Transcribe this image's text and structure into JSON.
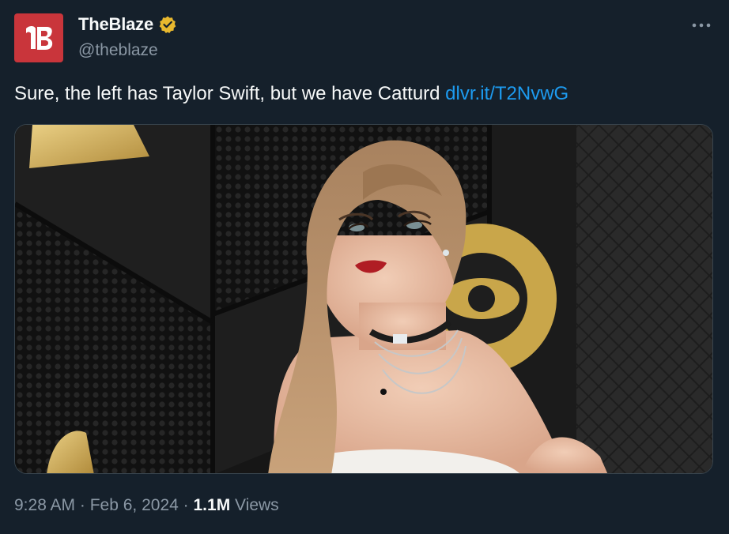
{
  "author": {
    "display_name": "TheBlaze",
    "handle": "@theblaze",
    "verified": true,
    "avatar_icon": "blaze-logo-icon",
    "avatar_color": "#c9353b",
    "badge_color": "#e8b82e"
  },
  "menu": {
    "icon": "more-icon"
  },
  "tweet": {
    "text": "Sure, the left has Taylor Swift, but we have Catturd ",
    "link_text": "dlvr.it/T2NvwG",
    "link_color": "#1d9bf0"
  },
  "media": {
    "type": "photo"
  },
  "meta": {
    "time": "9:28 AM",
    "separator": " · ",
    "date": "Feb 6, 2024",
    "separator2": " · ",
    "views_count": "1.1M",
    "views_label": " Views"
  },
  "colors": {
    "background": "#15202b",
    "text_primary": "#f7f9f9",
    "text_secondary": "#8b98a5"
  }
}
